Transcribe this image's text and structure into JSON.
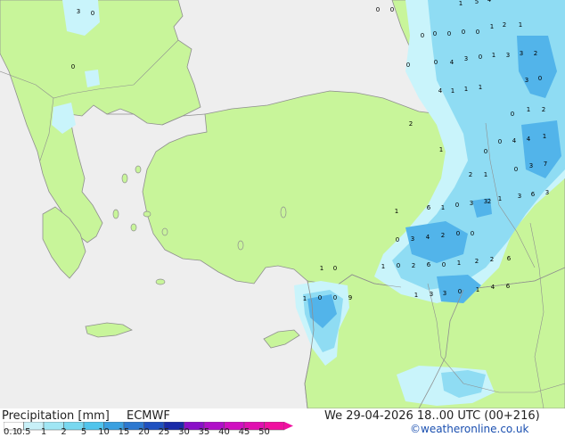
{
  "legend": {
    "title": "Precipitation [mm]",
    "model": "ECMWF",
    "levels": [
      "0.1",
      "0.5",
      "1",
      "2",
      "5",
      "10",
      "15",
      "20",
      "25",
      "30",
      "35",
      "40",
      "45",
      "50"
    ],
    "colors": [
      "#ffffff",
      "#c8f0f8",
      "#a0e6f4",
      "#78d8f0",
      "#50c4ec",
      "#3aa0e0",
      "#2c78d0",
      "#1e50c0",
      "#1a2aa8",
      "#8a10c8",
      "#b010c8",
      "#d010c0",
      "#e010b0",
      "#f010a0"
    ]
  },
  "valid_time": "We 29-04-2026 18..00 UTC (00+216)",
  "credit": "©weatheronline.co.uk",
  "map_colors": {
    "sea": "#eeeeee",
    "land": "#c8f59a",
    "coast": "#8f8f8f",
    "rain_light": "#c9f4fb",
    "rain_mid": "#8fdcf3",
    "rain_heavy": "#52b4ea"
  },
  "grid_values": [
    "3",
    "0",
    "0",
    "0",
    "0",
    "1",
    "5",
    "4",
    "0",
    "0",
    "0",
    "0",
    "0",
    "1",
    "2",
    "1",
    "0",
    "0",
    "4",
    "3",
    "0",
    "1",
    "3",
    "3",
    "2",
    "3",
    "0",
    "4",
    "1",
    "1",
    "1",
    "0",
    "1",
    "2",
    "2",
    "0",
    "0",
    "4",
    "4",
    "1",
    "1",
    "2",
    "1",
    "0",
    "3",
    "7",
    "3",
    "1",
    "3",
    "6",
    "3",
    "1",
    "6",
    "1",
    "0",
    "3",
    "2",
    "0",
    "3",
    "4",
    "2",
    "0",
    "0",
    "1",
    "0",
    "1",
    "0",
    "2",
    "6",
    "0",
    "1",
    "2",
    "2",
    "6",
    "1",
    "0",
    "0",
    "9",
    "1",
    "3",
    "3",
    "0",
    "1",
    "4",
    "6"
  ]
}
